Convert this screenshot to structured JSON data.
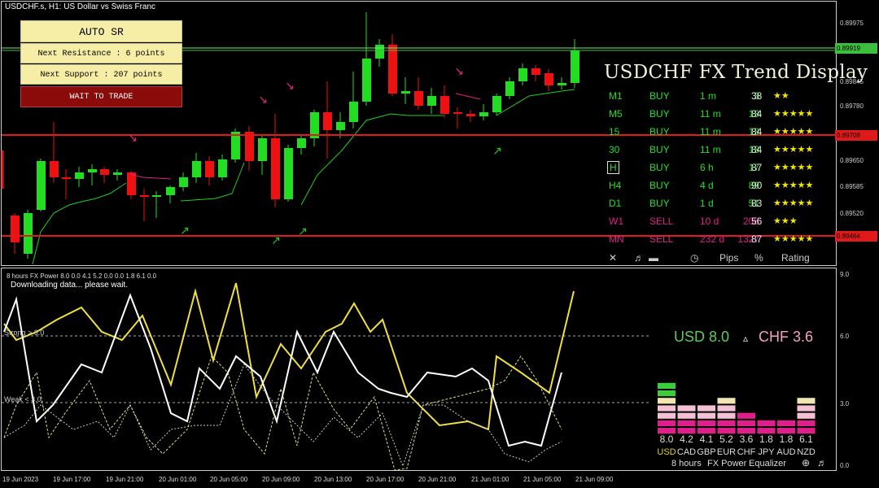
{
  "chart": {
    "title": "USDCHF.s, H1:  US Dollar vs Swiss Franc",
    "price_axis": [
      "0.89975",
      "0.89919",
      "0.89845",
      "0.89780",
      "0.89708",
      "0.89650",
      "0.89585",
      "0.89520",
      "0.89464"
    ],
    "time_axis": [
      "19 Jun 2023",
      "19 Jun 17:00",
      "19 Jun 21:00",
      "20 Jun 01:00",
      "20 Jun 05:00",
      "20 Jun 09:00",
      "20 Jun 13:00",
      "20 Jun 17:00",
      "20 Jun 21:00",
      "21 Jun 01:00",
      "21 Jun 05:00",
      "21 Jun 09:00"
    ],
    "resistance_label": "0.89708",
    "support_label": "0.89464",
    "current_label": "0.89919"
  },
  "auto_sr": {
    "title": "AUTO SR",
    "next_resistance": "Next Resistance : 6 points",
    "next_support": "Next Support : 207 points",
    "status": "WAIT TO TRADE"
  },
  "trend_display": {
    "title": "USDCHF FX Trend Display",
    "rows": [
      {
        "tf": "M1",
        "signal": "BUY",
        "age": "1 m",
        "pips": "3",
        "pct": "38",
        "stars": "★★",
        "color": "#20e020"
      },
      {
        "tf": "M5",
        "signal": "BUY",
        "age": "11 m",
        "pips": "13",
        "pct": "84",
        "stars": "★★★★★",
        "color": "#20e020"
      },
      {
        "tf": "15",
        "signal": "BUY",
        "age": "11 m",
        "pips": "13",
        "pct": "84",
        "stars": "★★★★★",
        "color": "#20e020"
      },
      {
        "tf": "30",
        "signal": "BUY",
        "age": "11 m",
        "pips": "13",
        "pct": "84",
        "stars": "★★★★★",
        "color": "#20e020"
      },
      {
        "tf": "H",
        "signal": "BUY",
        "age": "6 h",
        "pips": "17",
        "pct": "87",
        "stars": "★★★★★",
        "color": "#20e020"
      },
      {
        "tf": "H4",
        "signal": "BUY",
        "age": "4 d",
        "pips": "89",
        "pct": "90",
        "stars": "★★★★★",
        "color": "#20e020"
      },
      {
        "tf": "D1",
        "signal": "BUY",
        "age": "1 d",
        "pips": "51",
        "pct": "83",
        "stars": "★★★★★",
        "color": "#20e020"
      },
      {
        "tf": "W1",
        "signal": "SELL",
        "age": "10 d",
        "pips": "208",
        "pct": "56",
        "stars": "★★★",
        "color": "#e0208a"
      },
      {
        "tf": "MN",
        "signal": "SELL",
        "age": "232 d",
        "pips": "1327",
        "pct": "87",
        "stars": "★★★★★",
        "color": "#e0208a"
      }
    ],
    "footer": {
      "close": "✕",
      "sound": "♬",
      "clock": "🕓",
      "pips": "Pips",
      "pct": "%",
      "rating": "Rating"
    }
  },
  "indicator": {
    "title": "8 hours FX Power 8.0 0.0 4.1 5.2 0.0 0.0 1.8 6.1 0.0",
    "status": "Downloading data... please wait.",
    "strong_label": "Strong > 6.0",
    "weak_label": "Weak < 3.0",
    "axis": [
      "9.0",
      "6.0",
      "3.0",
      "0.0"
    ],
    "pair_usd": "USD 8.0",
    "pair_sep": "▵",
    "pair_chf": "CHF 3.6",
    "values": [
      "8.0",
      "4.2",
      "4.1",
      "5.2",
      "3.6",
      "1.8",
      "1.8",
      "6.1"
    ],
    "currencies": [
      "USD",
      "CAD",
      "GBP",
      "EUR",
      "CHF",
      "JPY",
      "AUD",
      "NZD"
    ],
    "levels": [
      8.0,
      4.2,
      4.1,
      5.2,
      3.6,
      1.8,
      1.8,
      6.1
    ],
    "footer": {
      "period": "8 hours",
      "name": "FX Power",
      "mode": "Equalizer"
    },
    "colors": {
      "usd": "#e6d21c",
      "chf": "#f4a0c8",
      "up": "#3ccc3c",
      "down": "#e0208a"
    }
  }
}
